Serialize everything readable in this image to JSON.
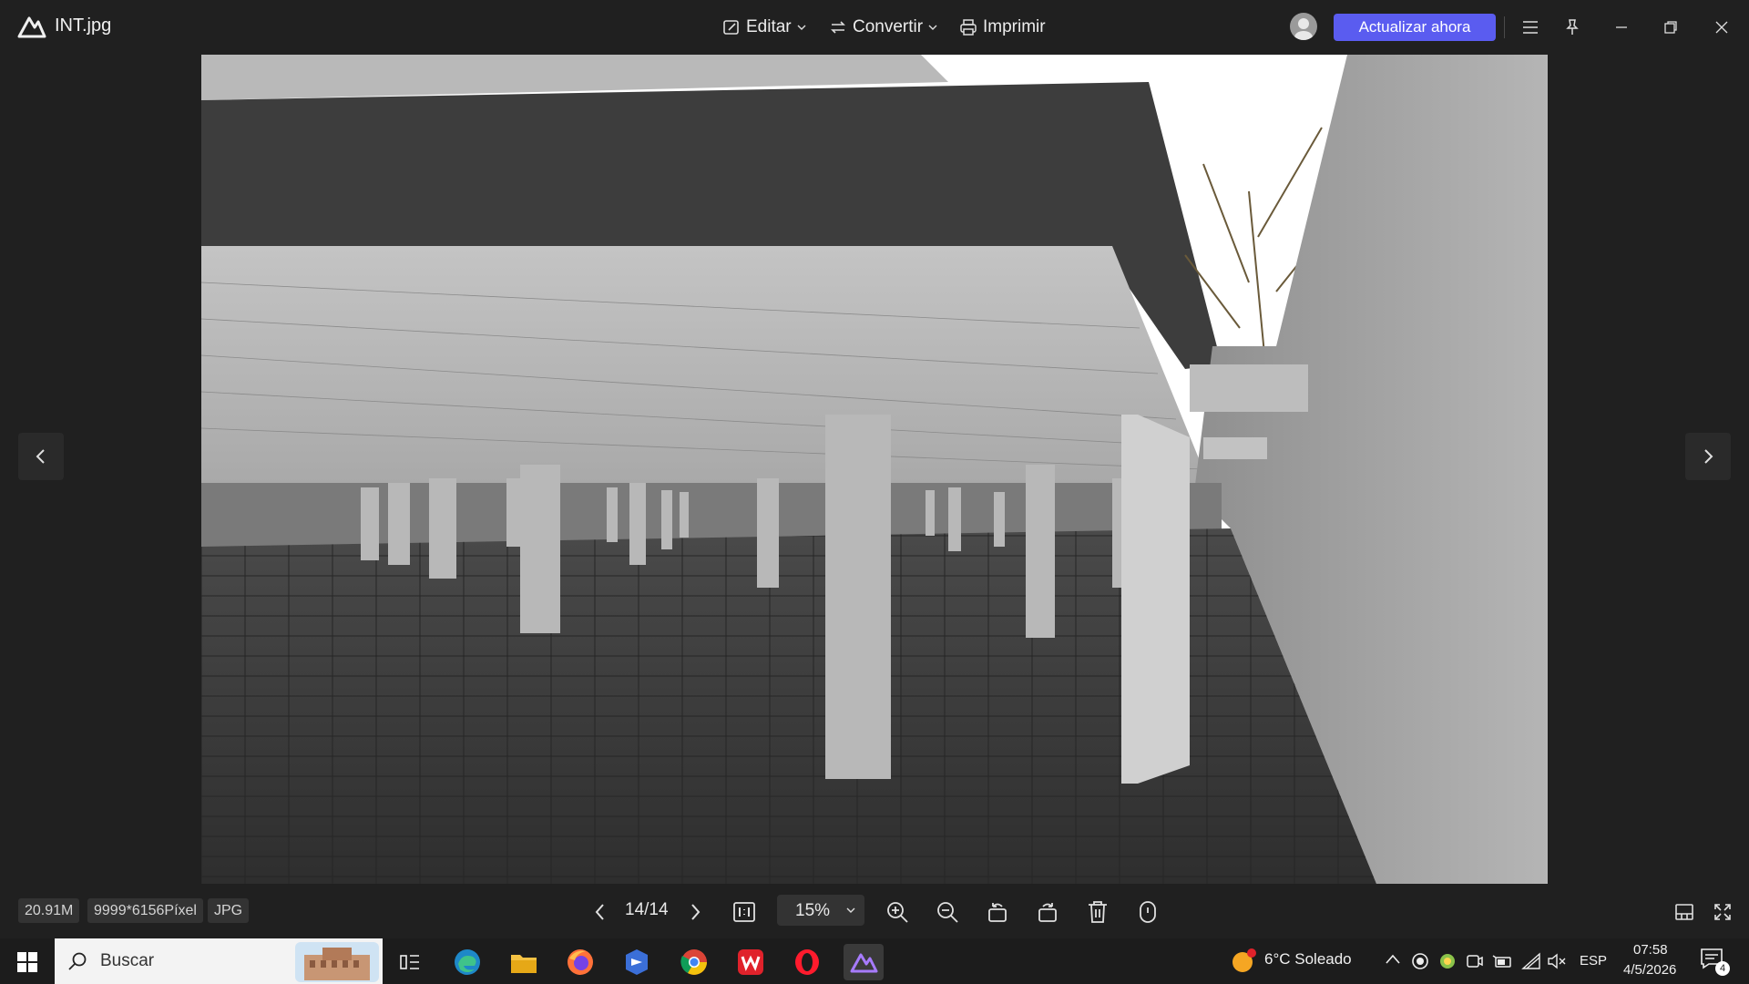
{
  "window": {
    "file_name": "INT.jpg",
    "menu": {
      "edit": "Editar",
      "convert": "Convertir",
      "print": "Imprimir"
    },
    "upgrade_label": "Actualizar ahora"
  },
  "image_info": {
    "size": "20.91M",
    "dimensions": "9999*6156Píxel",
    "format": "JPG"
  },
  "viewer": {
    "page_counter": "14/14",
    "zoom": "15%"
  },
  "taskbar": {
    "search_placeholder": "Buscar",
    "weather": "6°C Soleado",
    "language": "ESP",
    "time": "07:58",
    "date": "4/5/2026",
    "notification_count": "4"
  },
  "colors": {
    "accent": "#5a5cf0",
    "background": "#202020"
  },
  "icons": [
    "app-logo-icon",
    "edit-icon",
    "convert-icon",
    "print-icon",
    "avatar-icon",
    "menu-icon",
    "pin-icon",
    "minimize-icon",
    "restore-icon",
    "close-icon",
    "prev-image-icon",
    "next-image-icon",
    "prev-page-icon",
    "next-page-icon",
    "actual-size-icon",
    "zoom-in-icon",
    "zoom-out-icon",
    "rotate-left-icon",
    "rotate-right-icon",
    "delete-icon",
    "info-icon",
    "thumbnail-icon",
    "fullscreen-icon",
    "windows-start-icon",
    "search-icon",
    "task-view-icon",
    "edge-icon",
    "file-explorer-icon",
    "firefox-icon",
    "copilot-icon",
    "chrome-icon",
    "wps-icon",
    "opera-icon",
    "photo-viewer-icon"
  ]
}
